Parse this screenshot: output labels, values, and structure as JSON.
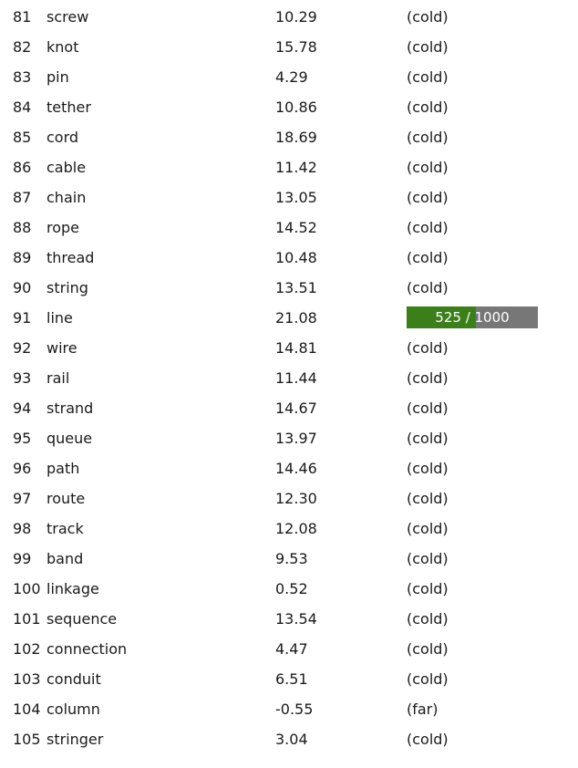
{
  "rows": [
    {
      "index": "81",
      "word": "screw",
      "score": "10.29",
      "status": "(cold)"
    },
    {
      "index": "82",
      "word": "knot",
      "score": "15.78",
      "status": "(cold)"
    },
    {
      "index": "83",
      "word": "pin",
      "score": "4.29",
      "status": "(cold)"
    },
    {
      "index": "84",
      "word": "tether",
      "score": "10.86",
      "status": "(cold)"
    },
    {
      "index": "85",
      "word": "cord",
      "score": "18.69",
      "status": "(cold)"
    },
    {
      "index": "86",
      "word": "cable",
      "score": "11.42",
      "status": "(cold)"
    },
    {
      "index": "87",
      "word": "chain",
      "score": "13.05",
      "status": "(cold)"
    },
    {
      "index": "88",
      "word": "rope",
      "score": "14.52",
      "status": "(cold)"
    },
    {
      "index": "89",
      "word": "thread",
      "score": "10.48",
      "status": "(cold)"
    },
    {
      "index": "90",
      "word": "string",
      "score": "13.51",
      "status": "(cold)"
    },
    {
      "index": "91",
      "word": "line",
      "score": "21.08",
      "status": "",
      "progress": {
        "label": "525 / 1000",
        "value": 525,
        "max": 1000
      }
    },
    {
      "index": "92",
      "word": "wire",
      "score": "14.81",
      "status": "(cold)"
    },
    {
      "index": "93",
      "word": "rail",
      "score": "11.44",
      "status": "(cold)"
    },
    {
      "index": "94",
      "word": "strand",
      "score": "14.67",
      "status": "(cold)"
    },
    {
      "index": "95",
      "word": "queue",
      "score": "13.97",
      "status": "(cold)"
    },
    {
      "index": "96",
      "word": "path",
      "score": "14.46",
      "status": "(cold)"
    },
    {
      "index": "97",
      "word": "route",
      "score": "12.30",
      "status": "(cold)"
    },
    {
      "index": "98",
      "word": "track",
      "score": "12.08",
      "status": "(cold)"
    },
    {
      "index": "99",
      "word": "band",
      "score": "9.53",
      "status": "(cold)"
    },
    {
      "index": "100",
      "word": "linkage",
      "score": "0.52",
      "status": "(cold)"
    },
    {
      "index": "101",
      "word": "sequence",
      "score": "13.54",
      "status": "(cold)"
    },
    {
      "index": "102",
      "word": "connection",
      "score": "4.47",
      "status": "(cold)"
    },
    {
      "index": "103",
      "word": "conduit",
      "score": "6.51",
      "status": "(cold)"
    },
    {
      "index": "104",
      "word": "column",
      "score": "-0.55",
      "status": "(far)"
    },
    {
      "index": "105",
      "word": "stringer",
      "score": "3.04",
      "status": "(cold)"
    }
  ],
  "colors": {
    "progress_fill": "#3c7f1a",
    "progress_track": "#777777",
    "progress_text": "#ffffff"
  }
}
